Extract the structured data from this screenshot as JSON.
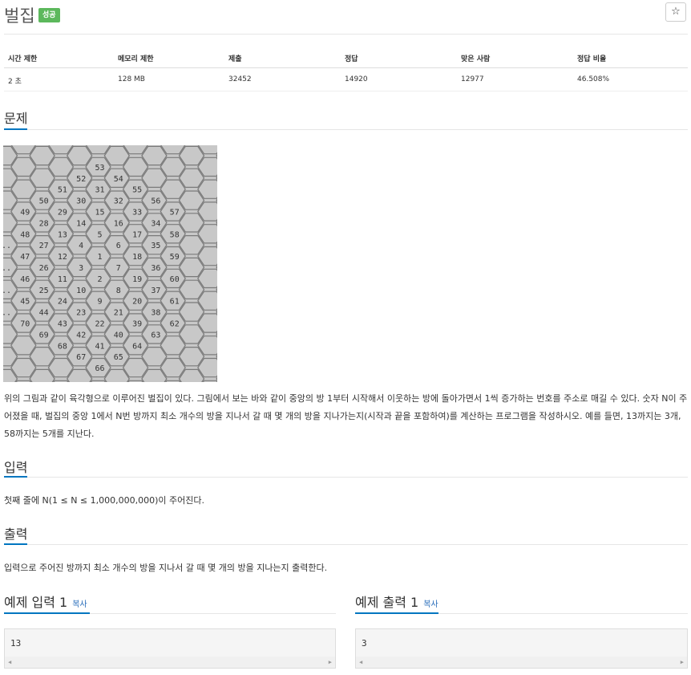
{
  "problem": {
    "title": "벌집",
    "status_badge": "성공",
    "star_icon": "star-icon"
  },
  "stats": {
    "headers": [
      "시간 제한",
      "메모리 제한",
      "제출",
      "정답",
      "맞은 사람",
      "정답 비율"
    ],
    "values": [
      "2 초",
      "128 MB",
      "32452",
      "14920",
      "12977",
      "46.508%"
    ]
  },
  "sections": {
    "problem_heading": "문제",
    "problem_text": "위의 그림과 같이 육각형으로 이루어진 벌집이 있다. 그림에서 보는 바와 같이 중앙의 방 1부터 시작해서 이웃하는 방에 돌아가면서 1씩 증가하는 번호를 주소로 매길 수 있다. 숫자 N이 주어졌을 때, 벌집의 중앙 1에서 N번 방까지 최소 개수의 방을 지나서 갈 때 몇 개의 방을 지나가는지(시작과 끝을 포함하여)를 계산하는 프로그램을 작성하시오. 예를 들면, 13까지는 3개, 58까지는 5개를 지난다.",
    "input_heading": "입력",
    "input_text": "첫째 줄에 N(1 ≤ N ≤ 1,000,000,000)이 주어진다.",
    "output_heading": "출력",
    "output_text": "입력으로 주어진 방까지 최소 개수의 방을 지나서 갈 때 몇 개의 방을 지나는지 출력한다."
  },
  "figure": {
    "cells": [
      [
        "53"
      ],
      [
        "52",
        "54"
      ],
      [
        "51",
        "31",
        "55"
      ],
      [
        "50",
        "30",
        "32",
        "56"
      ],
      [
        "49",
        "29",
        "15",
        "33",
        "57"
      ],
      [
        "28",
        "14",
        "16",
        "34"
      ],
      [
        "48",
        "13",
        "5",
        "17",
        "58"
      ],
      [
        "..",
        "27",
        "4",
        "6",
        "35"
      ],
      [
        "47",
        "12",
        "1",
        "18",
        "59"
      ],
      [
        "..",
        "26",
        "3",
        "7",
        "36"
      ],
      [
        "46",
        "11",
        "2",
        "19",
        "60"
      ],
      [
        "..",
        "25",
        "10",
        "8",
        "37"
      ],
      [
        "45",
        "24",
        "9",
        "20",
        "61"
      ],
      [
        "..",
        "44",
        "23",
        "21",
        "38"
      ],
      [
        "70",
        "43",
        "22",
        "39",
        "62"
      ],
      [
        "69",
        "42",
        "40",
        "63"
      ],
      [
        "68",
        "41",
        "64"
      ],
      [
        "67",
        "65"
      ],
      [
        "66"
      ]
    ]
  },
  "samples": {
    "input_heading": "예제 입력 1",
    "output_heading": "예제 출력 1",
    "copy_label": "복사",
    "input_value": "13",
    "output_value": "3",
    "left_arrow": "◀",
    "right_arrow": "▶"
  }
}
